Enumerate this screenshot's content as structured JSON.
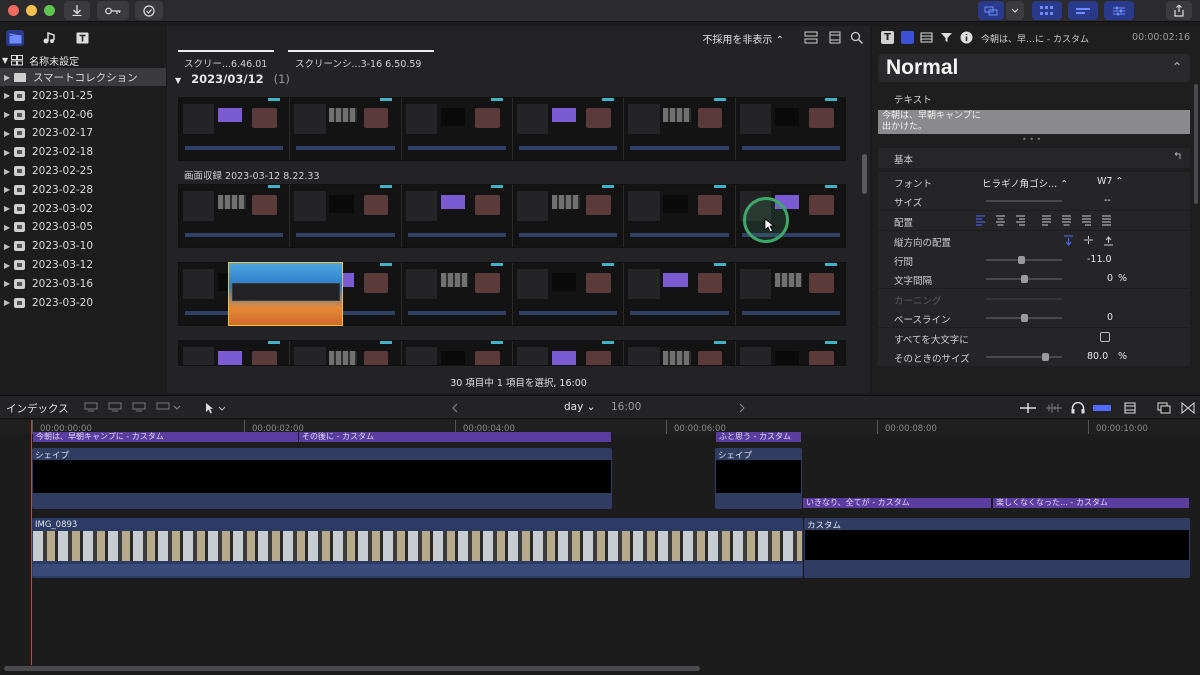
{
  "toolbar": {
    "time": "2:16"
  },
  "sidebar": {
    "library_name": "名称未設定",
    "items": [
      {
        "label": "スマートコレクション",
        "kind": "folder",
        "selected": true
      },
      {
        "label": "2023-01-25"
      },
      {
        "label": "2023-02-06"
      },
      {
        "label": "2023-02-17"
      },
      {
        "label": "2023-02-18"
      },
      {
        "label": "2023-02-25"
      },
      {
        "label": "2023-02-28"
      },
      {
        "label": "2023-03-02"
      },
      {
        "label": "2023-03-05"
      },
      {
        "label": "2023-03-10"
      },
      {
        "label": "2023-03-12"
      },
      {
        "label": "2023-03-16"
      },
      {
        "label": "2023-03-20"
      }
    ]
  },
  "browser": {
    "filter": "不採用を非表示 ⌃",
    "clips_top": [
      "スクリー...6.46.01",
      "スクリーンシ...3-16 6.50.59"
    ],
    "date_group": "2023/03/12",
    "date_group_count": "(1)",
    "recording_label": "画面収録 2023-03-12 8.22.33",
    "status": "30 項目中 1 項目を選択, 16:00"
  },
  "inspector": {
    "title_text": "今朝は、早…に - カスタム",
    "timecode": "00:00:02:16",
    "preset": "Normal",
    "section_text": "テキスト",
    "text_content_line1": "今朝は、早朝キャンプに",
    "text_content_line2": "出かけた。",
    "section_basic": "基本",
    "rows": {
      "font_label": "フォント",
      "font_value": "ヒラギノ角ゴシ... ⌃",
      "font_weight": "W7 ⌃",
      "size_label": "サイズ",
      "size_value": "--",
      "align_label": "配置",
      "vertical_label": "縦方向の配置",
      "line_spacing_label": "行間",
      "line_spacing_value": "-11.0",
      "tracking_label": "文字間隔",
      "tracking_value": "0",
      "tracking_unit": "%",
      "kerning_label": "カーニング",
      "baseline_label": "ベースライン",
      "baseline_value": "0",
      "allcaps_label": "すべてを大文字に",
      "allcaps_size_label": "そのときのサイズ",
      "allcaps_size_value": "80.0",
      "allcaps_size_unit": "%"
    },
    "sliders": {
      "line_spacing": 0.45,
      "tracking": 0.5,
      "baseline": 0.5,
      "allcaps_size": 0.8
    }
  },
  "timeline_bar": {
    "index_label": "インデックス",
    "project": "day ⌄",
    "duration": "16:00"
  },
  "timeline": {
    "timecodes": [
      "00:00:00:00",
      "00:00:02:00",
      "00:00:04:00",
      "00:00:06:00",
      "00:00:08:00",
      "00:00:10:00"
    ],
    "title_clips": [
      "今朝は、早朝キャンプに - カスタム",
      "その後に - カスタム",
      "ふと思う - カスタム",
      "いきなり、全てが - カスタム",
      "楽しくなくなった… - カスタム"
    ],
    "generator_clips": [
      "シェイプ",
      "シェイプ",
      "カスタム"
    ],
    "video_clip": "IMG_0893"
  },
  "colors": {
    "accent_blue": "#2a3a8a",
    "title_purple": "#5b3da0",
    "clip_blue": "#313c63",
    "playhead": "#b84a3a",
    "cursor_green": "#3ea86a"
  }
}
